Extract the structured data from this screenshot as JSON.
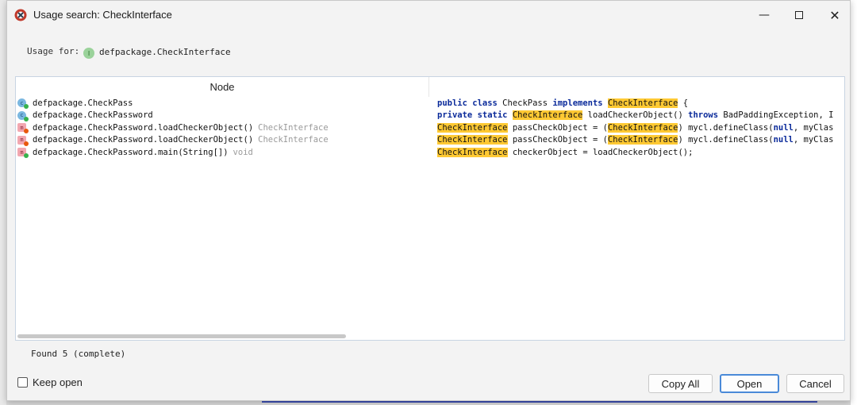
{
  "window": {
    "title": "Usage search: CheckInterface",
    "app_icon": "jadx-icon",
    "controls": [
      "minimize-icon",
      "maximize-icon",
      "close-icon"
    ]
  },
  "usage": {
    "label": "Usage for:",
    "icon_letter": "I",
    "value": "defpackage.CheckInterface"
  },
  "table": {
    "column_node": "Node",
    "rows": [
      {
        "icon_letter": "c",
        "icon_type": "class",
        "dot": "green",
        "node": "defpackage.CheckPass",
        "hint": "",
        "code": [
          {
            "t": "public class",
            "s": "kw"
          },
          {
            "t": " CheckPass ",
            "s": ""
          },
          {
            "t": "implements",
            "s": "kw"
          },
          {
            "t": " ",
            "s": ""
          },
          {
            "t": "CheckInterface",
            "s": "hl"
          },
          {
            "t": " {",
            "s": ""
          }
        ]
      },
      {
        "icon_letter": "c",
        "icon_type": "class",
        "dot": "green",
        "node": "defpackage.CheckPassword",
        "hint": "",
        "code": [
          {
            "t": "private static",
            "s": "kw"
          },
          {
            "t": " ",
            "s": ""
          },
          {
            "t": "CheckInterface",
            "s": "hl"
          },
          {
            "t": " loadCheckerObject() ",
            "s": ""
          },
          {
            "t": "throws",
            "s": "kw"
          },
          {
            "t": " BadPaddingException, I",
            "s": ""
          }
        ]
      },
      {
        "icon_letter": "m",
        "icon_type": "method",
        "dot": "orange",
        "node": "defpackage.CheckPassword.loadCheckerObject()",
        "hint": "CheckInterface",
        "code": [
          {
            "t": "CheckInterface",
            "s": "hl"
          },
          {
            "t": " passCheckObject = (",
            "s": ""
          },
          {
            "t": "CheckInterface",
            "s": "hl"
          },
          {
            "t": ") mycl.defineClass(",
            "s": ""
          },
          {
            "t": "null",
            "s": "kw"
          },
          {
            "t": ", myClas",
            "s": ""
          }
        ]
      },
      {
        "icon_letter": "m",
        "icon_type": "method",
        "dot": "orange",
        "node": "defpackage.CheckPassword.loadCheckerObject()",
        "hint": "CheckInterface",
        "code": [
          {
            "t": "CheckInterface",
            "s": "hl"
          },
          {
            "t": " passCheckObject = (",
            "s": ""
          },
          {
            "t": "CheckInterface",
            "s": "hl"
          },
          {
            "t": ") mycl.defineClass(",
            "s": ""
          },
          {
            "t": "null",
            "s": "kw"
          },
          {
            "t": ", myClas",
            "s": ""
          }
        ]
      },
      {
        "icon_letter": "m",
        "icon_type": "method",
        "dot": "green",
        "node": "defpackage.CheckPassword.main(String[])",
        "hint": "void",
        "code": [
          {
            "t": "CheckInterface",
            "s": "hl"
          },
          {
            "t": " checkerObject = loadCheckerObject();",
            "s": ""
          }
        ]
      }
    ]
  },
  "status": "Found 5 (complete)",
  "footer": {
    "keep_open_label": "Keep open",
    "keep_open_checked": false,
    "copy_all_label": "Copy All",
    "open_label": "Open",
    "cancel_label": "Cancel"
  },
  "colors": {
    "highlight": "#ffc933",
    "keyword": "#0a2a9a",
    "focus_border": "#4a8ad8"
  }
}
